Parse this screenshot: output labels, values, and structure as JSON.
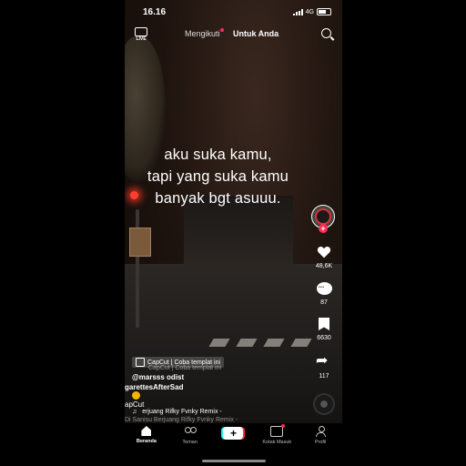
{
  "status_bar": {
    "time": "16.16",
    "network": "4G"
  },
  "top_nav": {
    "live_label": "LIVE",
    "following": "Mengikuti",
    "for_you": "Untuk Anda"
  },
  "caption": {
    "lines": [
      "aku suka kamu,",
      "tapi yang suka kamu",
      "banyak bgt asuuu."
    ]
  },
  "actions": {
    "likes": "48,6K",
    "comments": "87",
    "bookmarks": "6630",
    "shares": "117"
  },
  "capcut": {
    "badge": "CapCut | Coba templat ini",
    "ghost": "CapCut | Coba templat ini"
  },
  "post": {
    "username": "@marsss odist",
    "description_1": "garettesAfterSad",
    "description_2": "apCut",
    "music": "erjuang Rifky Fvnky Remix -",
    "music_ghost": "Di Sanisu Berjuang Rifky Fvnky Remix -"
  },
  "bottom_nav": {
    "home": "Beranda",
    "friends": "Teman",
    "create": "+",
    "inbox": "Kotak Masuk",
    "profile": "Profil"
  },
  "colors": {
    "accent": "#fe2c55",
    "cyan": "#25f4ee"
  }
}
